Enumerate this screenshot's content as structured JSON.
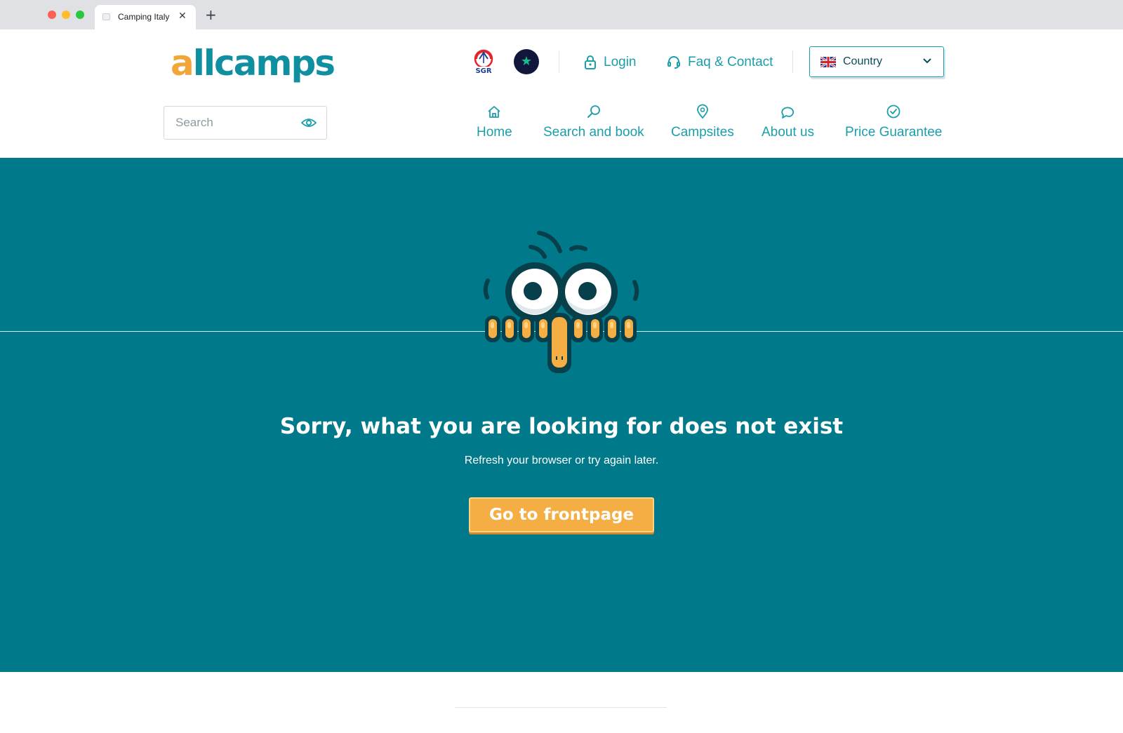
{
  "browser": {
    "tab_title": "Camping Italy",
    "tab_close": "✕",
    "new_tab": "+"
  },
  "header": {
    "logo": {
      "first": "a",
      "rest": "llcamps"
    },
    "login": "Login",
    "faq": "Faq & Contact",
    "country": "Country"
  },
  "search": {
    "placeholder": "Search"
  },
  "nav": {
    "items": [
      {
        "label": "Home",
        "icon": "home-icon"
      },
      {
        "label": "Search and book",
        "icon": "search-icon"
      },
      {
        "label": "Campsites",
        "icon": "map-pin-icon"
      },
      {
        "label": "About us",
        "icon": "speech-bubble-icon"
      },
      {
        "label": "Price Guarantee",
        "icon": "check-circle-icon"
      }
    ]
  },
  "hero": {
    "title": "Sorry, what you are looking for does not exist",
    "subtitle": "Refresh your browser or try again later.",
    "cta": "Go to frontpage"
  },
  "colors": {
    "primary": "#00798a",
    "accent": "#1b9eac",
    "button": "#f5ae43"
  }
}
